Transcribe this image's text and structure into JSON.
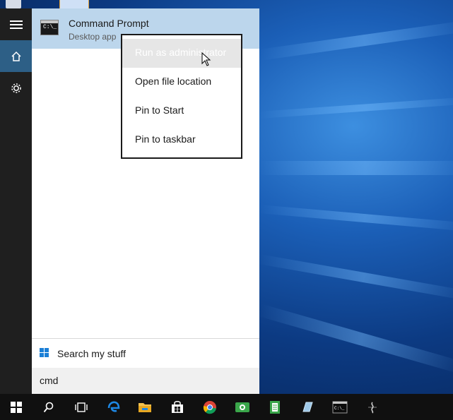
{
  "start_menu": {
    "result": {
      "title": "Command Prompt",
      "subtitle": "Desktop app",
      "icon_text": "C:\\_"
    },
    "search_stuff_label": "Search my stuff",
    "search_value": "cmd"
  },
  "context_menu": {
    "items": [
      {
        "label": "Run as administrator"
      },
      {
        "label": "Open file location"
      },
      {
        "label": "Pin to Start"
      },
      {
        "label": "Pin to taskbar"
      }
    ]
  },
  "taskbar": {
    "icons": [
      "windows-start-icon",
      "search-icon",
      "task-view-icon",
      "edge-icon",
      "file-explorer-icon",
      "store-icon",
      "chrome-icon",
      "camera-icon",
      "notes-icon",
      "app-icon",
      "command-prompt-icon",
      "settings-icon"
    ]
  },
  "colors": {
    "highlight": "#bcd6ec",
    "rail_active": "#2d5f86",
    "accent": "#1b7fd6"
  }
}
